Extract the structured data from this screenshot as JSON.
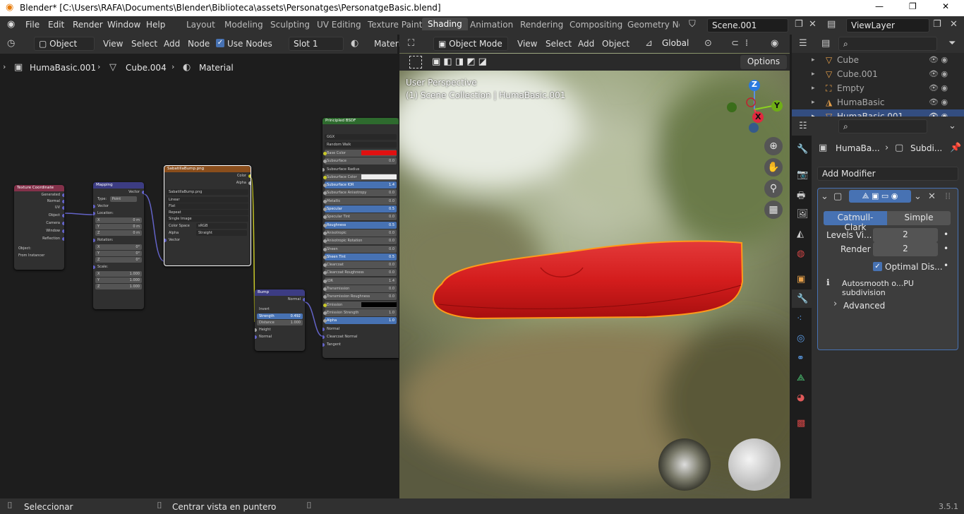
{
  "window": {
    "title": "Blender* [C:\\Users\\RAFA\\Documents\\Blender\\Biblioteca\\assets\\Personatges\\PersonatgeBasic.blend]",
    "minimize": "—",
    "maximize": "❐",
    "close": "✕"
  },
  "menu": [
    "File",
    "Edit",
    "Render",
    "Window",
    "Help"
  ],
  "workspaces": [
    "Layout",
    "Modeling",
    "Sculpting",
    "UV Editing",
    "Texture Paint",
    "Shading",
    "Animation",
    "Rendering",
    "Compositing",
    "Geometry Noc"
  ],
  "scene": "Scene.001",
  "viewlayer": "ViewLayer",
  "node_editor": {
    "type": "Object",
    "menus": [
      "View",
      "Select",
      "Add",
      "Node"
    ],
    "use_nodes": "Use Nodes",
    "slot": "Slot 1",
    "material": "Materi",
    "breadcrumb": [
      "HumaBasic.001",
      "Cube.004",
      "Material"
    ]
  },
  "nodes": {
    "texcoord": {
      "title": "Texture Coordinate",
      "outputs": [
        "Generated",
        "Normal",
        "UV",
        "Object",
        "Camera",
        "Window",
        "Reflection"
      ],
      "object_label": "Object:",
      "from_instancer": "From Instancer"
    },
    "mapping": {
      "title": "Mapping",
      "vector": "Vector",
      "type_label": "Type:",
      "type_value": "Point",
      "in_vector": "Vector",
      "location": "Location:",
      "rotation": "Rotation:",
      "scale": "Scale:",
      "loc": [
        [
          "X",
          "0 m"
        ],
        [
          "Y",
          "0 m"
        ],
        [
          "Z",
          "0 m"
        ]
      ],
      "rot": [
        [
          "X",
          "0°"
        ],
        [
          "Y",
          "0°"
        ],
        [
          "Z",
          "0°"
        ]
      ],
      "scl": [
        [
          "X",
          "1.000"
        ],
        [
          "Y",
          "1.000"
        ],
        [
          "Z",
          "1.000"
        ]
      ]
    },
    "image": {
      "title": "SabatillaBump.png",
      "color": "Color",
      "alpha": "Alpha",
      "file": "SabatillaBump.png",
      "options": [
        "Linear",
        "Flat",
        "Repeat",
        "Single Image"
      ],
      "colorspace_label": "Color Space",
      "colorspace": "sRGB",
      "alpha_label": "Alpha",
      "alpha_mode": "Straight",
      "vector": "Vector"
    },
    "bump": {
      "title": "Bump",
      "normal": "Normal",
      "invert": "Invert",
      "strength_label": "Strength",
      "strength": "0.492",
      "distance_label": "Distance",
      "distance": "1.000",
      "height": "Height",
      "in_normal": "Normal"
    },
    "bsdf": {
      "title": "Principled BSDF",
      "dist": "GGX",
      "sss": "Random Walk",
      "rows": [
        [
          "Base Color",
          "",
          false
        ],
        [
          "Subsurface",
          "0.0",
          false
        ],
        [
          "Subsurface Radius",
          "",
          false
        ],
        [
          "Subsurface Color",
          "",
          false
        ],
        [
          "Subsurface IOR",
          "1.4",
          true
        ],
        [
          "Subsurface Anisotropy",
          "0.0",
          false
        ],
        [
          "Metallic",
          "0.0",
          false
        ],
        [
          "Specular",
          "0.5",
          true
        ],
        [
          "Specular Tint",
          "0.0",
          false
        ],
        [
          "Roughness",
          "0.5",
          true
        ],
        [
          "Anisotropic",
          "0.0",
          false
        ],
        [
          "Anisotropic Rotation",
          "0.0",
          false
        ],
        [
          "Sheen",
          "0.0",
          false
        ],
        [
          "Sheen Tint",
          "0.5",
          true
        ],
        [
          "Clearcoat",
          "0.0",
          false
        ],
        [
          "Clearcoat Roughness",
          "0.0",
          false
        ],
        [
          "IOR",
          "1.4",
          false
        ],
        [
          "Transmission",
          "0.0",
          false
        ],
        [
          "Transmission Roughness",
          "0.0",
          false
        ],
        [
          "Emission",
          "",
          false
        ],
        [
          "Emission Strength",
          "1.0",
          false
        ],
        [
          "Alpha",
          "1.0",
          true
        ],
        [
          "Normal",
          "",
          false
        ],
        [
          "Clearcoat Normal",
          "",
          false
        ],
        [
          "Tangent",
          "",
          false
        ]
      ]
    }
  },
  "viewport": {
    "mode": "Object Mode",
    "menus": [
      "View",
      "Select",
      "Add",
      "Object"
    ],
    "orientation": "Global",
    "options": "Options",
    "persp": "User Perspective",
    "collection": "(1) Scene Collection | HumaBasic.001",
    "axes": {
      "z": "Z",
      "y": "Y",
      "x": "X"
    }
  },
  "outliner": {
    "items": [
      {
        "name": "Cube"
      },
      {
        "name": "Cube.001"
      },
      {
        "name": "Empty"
      },
      {
        "name": "HumaBasic"
      },
      {
        "name": "HumaBasic.001"
      }
    ]
  },
  "properties": {
    "breadcrumb_obj": "HumaBa...",
    "breadcrumb_mod": "Subdi...",
    "add_modifier": "Add Modifier",
    "catmull": "Catmull-Clark",
    "simple": "Simple",
    "levels_label": "Levels Vi...",
    "levels": "2",
    "render_label": "Render",
    "render": "2",
    "optimal": "Optimal Dis...",
    "info": "Autosmooth o...PU subdivision",
    "advanced": "Advanced"
  },
  "status": {
    "select": "Seleccionar",
    "center": "Centrar vista en puntero",
    "version": "3.5.1"
  }
}
